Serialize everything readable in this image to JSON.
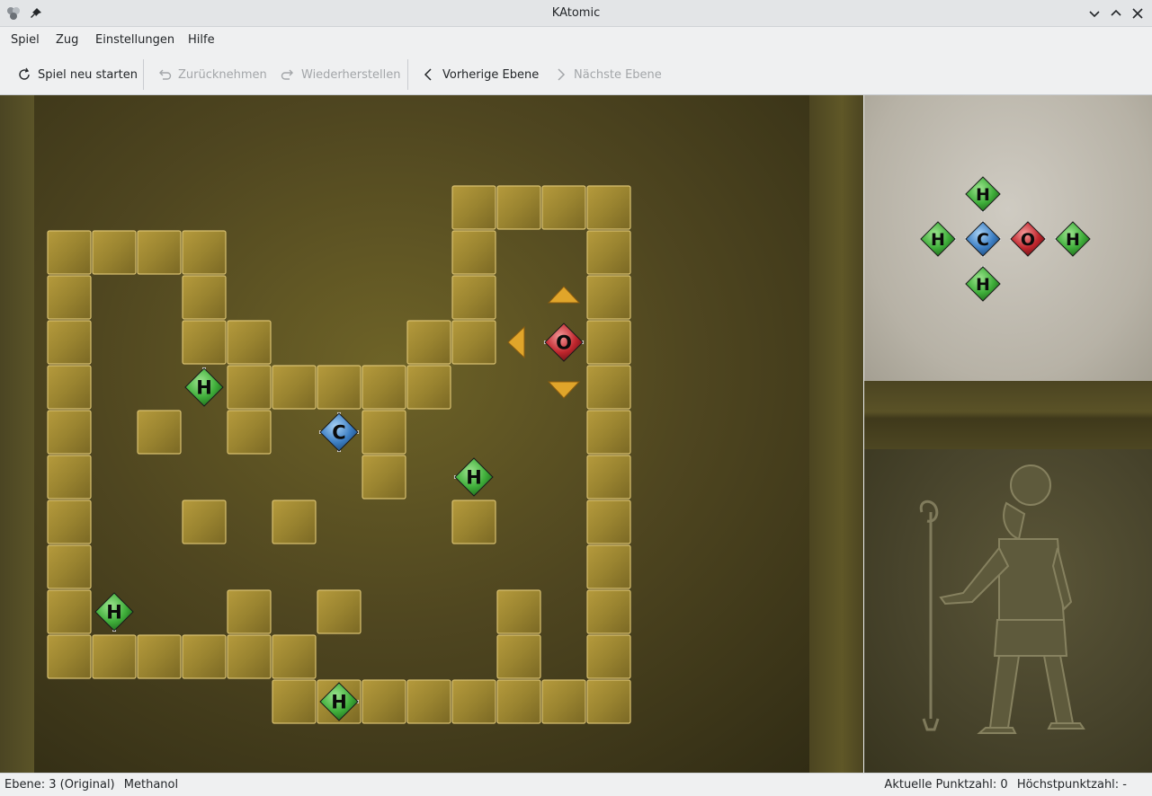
{
  "window": {
    "title": "KAtomic"
  },
  "menu": {
    "items": [
      "Spiel",
      "Zug",
      "Einstellungen",
      "Hilfe"
    ]
  },
  "toolbar": {
    "restart": "Spiel neu starten",
    "undo": "Zurücknehmen",
    "redo": "Wiederherstellen",
    "prev_level": "Vorherige Ebene",
    "next_level": "Nächste Ebene"
  },
  "board": {
    "atoms": [
      {
        "symbol": "H",
        "kind": "hydrogen"
      },
      {
        "symbol": "C",
        "kind": "carbon"
      },
      {
        "symbol": "H",
        "kind": "hydrogen"
      },
      {
        "symbol": "H",
        "kind": "hydrogen"
      },
      {
        "symbol": "H",
        "kind": "hydrogen"
      },
      {
        "symbol": "O",
        "kind": "oxygen",
        "selected": true
      }
    ]
  },
  "preview": {
    "atoms": [
      {
        "symbol": "H"
      },
      {
        "symbol": "H"
      },
      {
        "symbol": "C"
      },
      {
        "symbol": "O"
      },
      {
        "symbol": "H"
      },
      {
        "symbol": "H"
      }
    ]
  },
  "status": {
    "level": "Ebene: 3 (Original)",
    "molecule": "Methanol",
    "current_score": "Aktuelle Punktzahl: 0",
    "high_score": "Höchstpunktzahl: -"
  },
  "colors": {
    "hydrogen": "#3fae3a",
    "carbon": "#3d7fc4",
    "oxygen": "#c0262d",
    "wall": "#9a8430",
    "arrow": "#e0a52a"
  }
}
